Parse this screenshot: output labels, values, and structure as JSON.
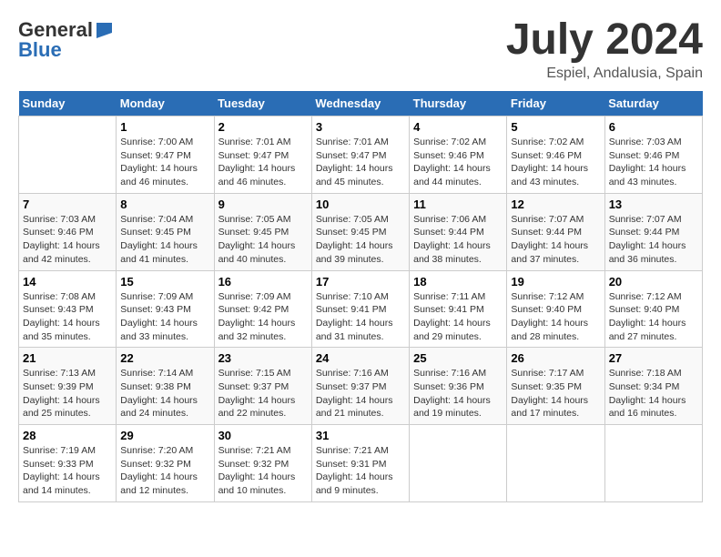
{
  "header": {
    "logo_general": "General",
    "logo_blue": "Blue",
    "month": "July 2024",
    "location": "Espiel, Andalusia, Spain"
  },
  "days_of_week": [
    "Sunday",
    "Monday",
    "Tuesday",
    "Wednesday",
    "Thursday",
    "Friday",
    "Saturday"
  ],
  "weeks": [
    [
      {
        "day": "",
        "info": ""
      },
      {
        "day": "1",
        "info": "Sunrise: 7:00 AM\nSunset: 9:47 PM\nDaylight: 14 hours\nand 46 minutes."
      },
      {
        "day": "2",
        "info": "Sunrise: 7:01 AM\nSunset: 9:47 PM\nDaylight: 14 hours\nand 46 minutes."
      },
      {
        "day": "3",
        "info": "Sunrise: 7:01 AM\nSunset: 9:47 PM\nDaylight: 14 hours\nand 45 minutes."
      },
      {
        "day": "4",
        "info": "Sunrise: 7:02 AM\nSunset: 9:46 PM\nDaylight: 14 hours\nand 44 minutes."
      },
      {
        "day": "5",
        "info": "Sunrise: 7:02 AM\nSunset: 9:46 PM\nDaylight: 14 hours\nand 43 minutes."
      },
      {
        "day": "6",
        "info": "Sunrise: 7:03 AM\nSunset: 9:46 PM\nDaylight: 14 hours\nand 43 minutes."
      }
    ],
    [
      {
        "day": "7",
        "info": "Sunrise: 7:03 AM\nSunset: 9:46 PM\nDaylight: 14 hours\nand 42 minutes."
      },
      {
        "day": "8",
        "info": "Sunrise: 7:04 AM\nSunset: 9:45 PM\nDaylight: 14 hours\nand 41 minutes."
      },
      {
        "day": "9",
        "info": "Sunrise: 7:05 AM\nSunset: 9:45 PM\nDaylight: 14 hours\nand 40 minutes."
      },
      {
        "day": "10",
        "info": "Sunrise: 7:05 AM\nSunset: 9:45 PM\nDaylight: 14 hours\nand 39 minutes."
      },
      {
        "day": "11",
        "info": "Sunrise: 7:06 AM\nSunset: 9:44 PM\nDaylight: 14 hours\nand 38 minutes."
      },
      {
        "day": "12",
        "info": "Sunrise: 7:07 AM\nSunset: 9:44 PM\nDaylight: 14 hours\nand 37 minutes."
      },
      {
        "day": "13",
        "info": "Sunrise: 7:07 AM\nSunset: 9:44 PM\nDaylight: 14 hours\nand 36 minutes."
      }
    ],
    [
      {
        "day": "14",
        "info": "Sunrise: 7:08 AM\nSunset: 9:43 PM\nDaylight: 14 hours\nand 35 minutes."
      },
      {
        "day": "15",
        "info": "Sunrise: 7:09 AM\nSunset: 9:43 PM\nDaylight: 14 hours\nand 33 minutes."
      },
      {
        "day": "16",
        "info": "Sunrise: 7:09 AM\nSunset: 9:42 PM\nDaylight: 14 hours\nand 32 minutes."
      },
      {
        "day": "17",
        "info": "Sunrise: 7:10 AM\nSunset: 9:41 PM\nDaylight: 14 hours\nand 31 minutes."
      },
      {
        "day": "18",
        "info": "Sunrise: 7:11 AM\nSunset: 9:41 PM\nDaylight: 14 hours\nand 29 minutes."
      },
      {
        "day": "19",
        "info": "Sunrise: 7:12 AM\nSunset: 9:40 PM\nDaylight: 14 hours\nand 28 minutes."
      },
      {
        "day": "20",
        "info": "Sunrise: 7:12 AM\nSunset: 9:40 PM\nDaylight: 14 hours\nand 27 minutes."
      }
    ],
    [
      {
        "day": "21",
        "info": "Sunrise: 7:13 AM\nSunset: 9:39 PM\nDaylight: 14 hours\nand 25 minutes."
      },
      {
        "day": "22",
        "info": "Sunrise: 7:14 AM\nSunset: 9:38 PM\nDaylight: 14 hours\nand 24 minutes."
      },
      {
        "day": "23",
        "info": "Sunrise: 7:15 AM\nSunset: 9:37 PM\nDaylight: 14 hours\nand 22 minutes."
      },
      {
        "day": "24",
        "info": "Sunrise: 7:16 AM\nSunset: 9:37 PM\nDaylight: 14 hours\nand 21 minutes."
      },
      {
        "day": "25",
        "info": "Sunrise: 7:16 AM\nSunset: 9:36 PM\nDaylight: 14 hours\nand 19 minutes."
      },
      {
        "day": "26",
        "info": "Sunrise: 7:17 AM\nSunset: 9:35 PM\nDaylight: 14 hours\nand 17 minutes."
      },
      {
        "day": "27",
        "info": "Sunrise: 7:18 AM\nSunset: 9:34 PM\nDaylight: 14 hours\nand 16 minutes."
      }
    ],
    [
      {
        "day": "28",
        "info": "Sunrise: 7:19 AM\nSunset: 9:33 PM\nDaylight: 14 hours\nand 14 minutes."
      },
      {
        "day": "29",
        "info": "Sunrise: 7:20 AM\nSunset: 9:32 PM\nDaylight: 14 hours\nand 12 minutes."
      },
      {
        "day": "30",
        "info": "Sunrise: 7:21 AM\nSunset: 9:32 PM\nDaylight: 14 hours\nand 10 minutes."
      },
      {
        "day": "31",
        "info": "Sunrise: 7:21 AM\nSunset: 9:31 PM\nDaylight: 14 hours\nand 9 minutes."
      },
      {
        "day": "",
        "info": ""
      },
      {
        "day": "",
        "info": ""
      },
      {
        "day": "",
        "info": ""
      }
    ]
  ]
}
